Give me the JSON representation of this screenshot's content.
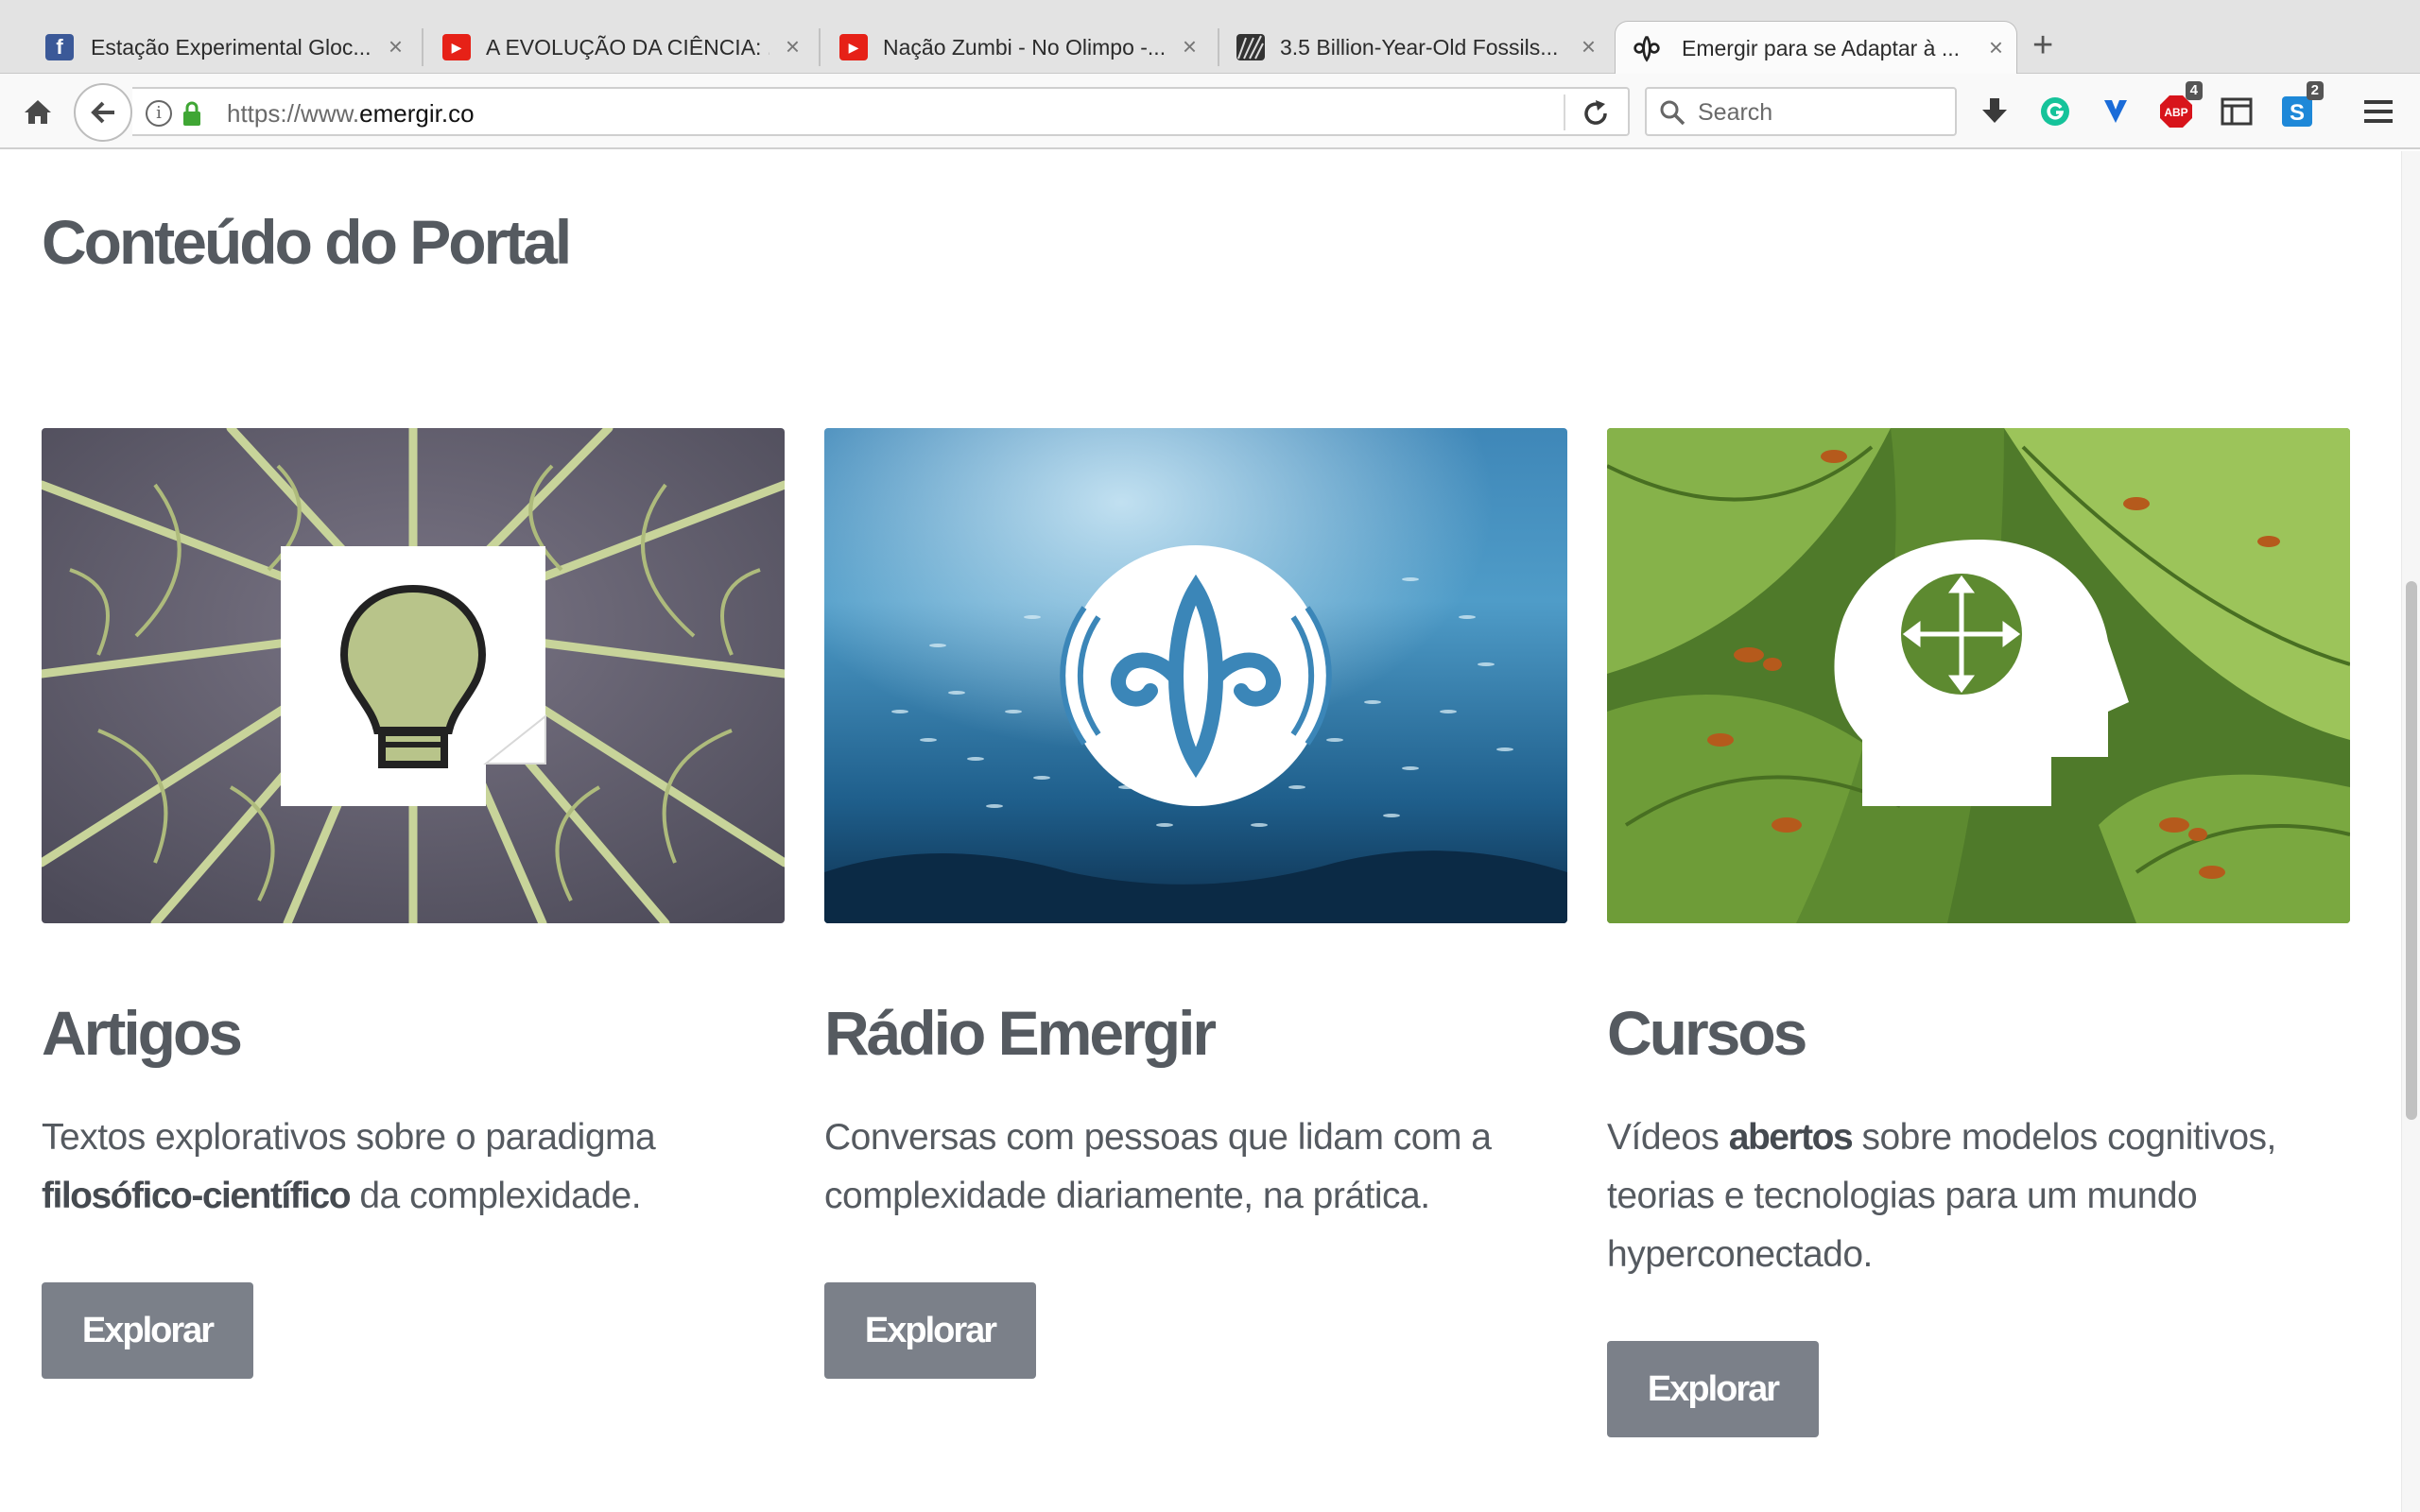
{
  "browser": {
    "tabs": [
      {
        "label": "Estação Experimental Gloc...",
        "favicon": "facebook-icon"
      },
      {
        "label": "A EVOLUÇÃO DA CIÊNCIA: ...",
        "favicon": "youtube-icon"
      },
      {
        "label": "Nação Zumbi - No Olimpo -...",
        "favicon": "youtube-icon"
      },
      {
        "label": "3.5 Billion-Year-Old Fossils...",
        "favicon": "image-icon"
      },
      {
        "label": "Emergir para se Adaptar à ...",
        "favicon": "emergir-logo-icon"
      }
    ],
    "active_tab_index": 4,
    "close_glyph": "×",
    "new_tab_glyph": "+",
    "url_prefix": "https://www.",
    "url_domain": "emergir.co",
    "search_placeholder": "Search",
    "badges": {
      "abp": "4",
      "s": "2"
    },
    "abp_label": "ABP",
    "s_label": "S"
  },
  "page": {
    "section_title": "Conteúdo do Portal",
    "cards": [
      {
        "title": "Artigos",
        "desc_parts": [
          "Textos explorativos sobre o paradigma ",
          "filosófico-científico",
          " da complexidade."
        ],
        "button": "Explorar"
      },
      {
        "title": "Rádio Emergir",
        "desc_parts": [
          "Conversas com pessoas que lidam com a complexidade diariamente, na prática."
        ],
        "button": "Explorar"
      },
      {
        "title": "Cursos",
        "desc_parts": [
          "Vídeos ",
          "abertos",
          " sobre modelos cognitivos, teorias e tecnologias para um mundo hyperconectado."
        ],
        "button": "Explorar"
      }
    ]
  },
  "colors": {
    "text": "#555a60",
    "button": "#7b8089",
    "facebook": "#3b5998",
    "youtube": "#e62117",
    "lock": "#3fa634",
    "grammarly": "#15c39a"
  }
}
